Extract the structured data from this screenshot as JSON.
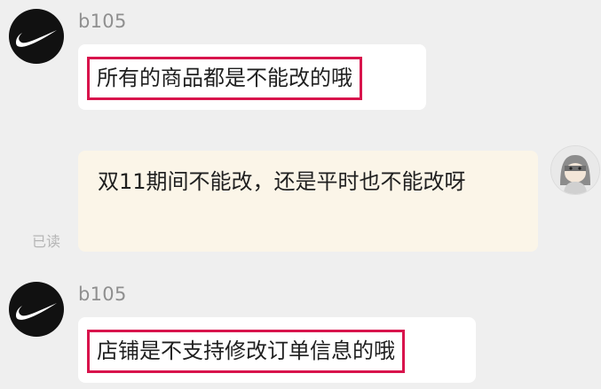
{
  "messages": [
    {
      "sender": "b105",
      "text": "所有的商品都是不能改的哦"
    },
    {
      "text": "双11期间不能改，还是平时也不能改呀",
      "read_status": "已读"
    },
    {
      "sender": "b105",
      "text": "店铺是不支持修改订单信息的哦"
    }
  ],
  "colors": {
    "background": "#efefef",
    "incoming_bubble": "#ffffff",
    "outgoing_bubble": "#fbf5e8",
    "highlight_border": "#d8144c",
    "sender_text": "#8f8f8f",
    "read_status_text": "#b5b5b5"
  },
  "icons": {
    "brand_avatar": "swoosh-icon",
    "user_avatar": "cartoon-character-avatar"
  }
}
